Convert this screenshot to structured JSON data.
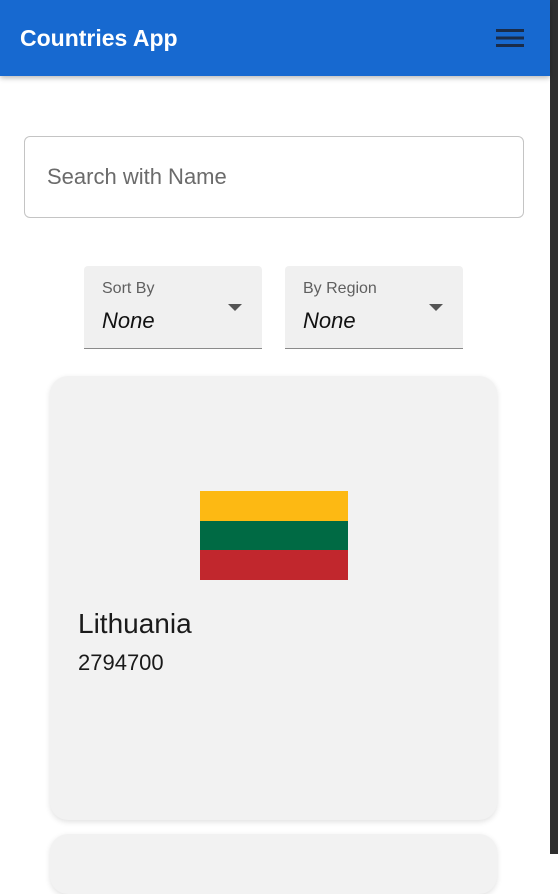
{
  "appbar": {
    "title": "Countries App",
    "menu_icon": "hamburger-menu-icon"
  },
  "search": {
    "placeholder": "Search with Name",
    "value": ""
  },
  "filters": {
    "sort": {
      "label": "Sort By",
      "value": "None"
    },
    "region": {
      "label": "By Region",
      "value": "None"
    }
  },
  "countries": [
    {
      "name": "Lithuania",
      "population": "2794700",
      "flag": {
        "stripes": [
          "#fdb913",
          "#006a44",
          "#c1272d"
        ]
      }
    }
  ]
}
